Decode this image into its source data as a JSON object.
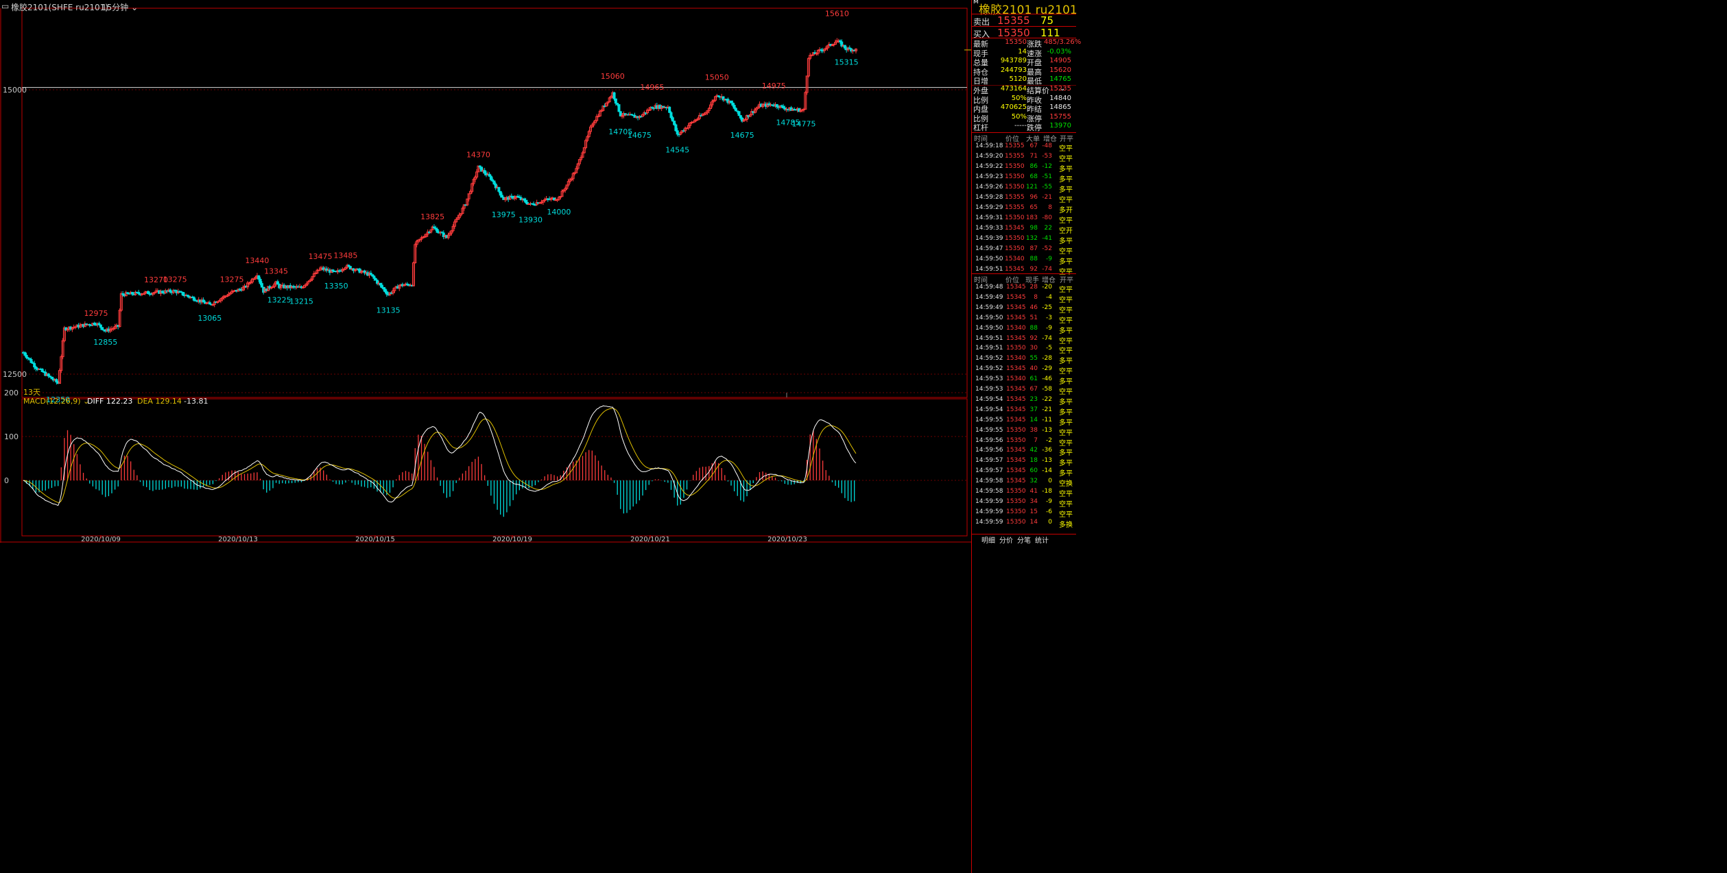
{
  "titlebar": {
    "menu_icon": "window-menu-icon",
    "symbol": "橡胶2101(SHFE ru2101)",
    "period": "15分钟",
    "period_icon": "chevron-down-icon"
  },
  "chart": {
    "y_axis": {
      "min": 12300,
      "max": 15800,
      "ticks": [
        15000,
        12500
      ]
    },
    "x_axis_labels": [
      "2020/10/09",
      "2020/10/13",
      "2020/10/15",
      "2020/10/19",
      "2020/10/21",
      "2020/10/23"
    ],
    "days_label": "13天",
    "hline_price": 15020,
    "last_price": 15350,
    "annotations": [
      {
        "bar": 22,
        "text": "12350",
        "type": "low"
      },
      {
        "bar": 46,
        "text": "12975",
        "type": "high"
      },
      {
        "bar": 52,
        "text": "12855",
        "type": "low"
      },
      {
        "bar": 84,
        "text": "13270",
        "type": "high"
      },
      {
        "bar": 96,
        "text": "13275",
        "type": "high"
      },
      {
        "bar": 118,
        "text": "13065",
        "type": "low"
      },
      {
        "bar": 132,
        "text": "13275",
        "type": "high"
      },
      {
        "bar": 148,
        "text": "13440",
        "type": "high"
      },
      {
        "bar": 160,
        "text": "13345",
        "type": "high"
      },
      {
        "bar": 162,
        "text": "13225",
        "type": "low"
      },
      {
        "bar": 176,
        "text": "13215",
        "type": "low"
      },
      {
        "bar": 188,
        "text": "13475",
        "type": "high"
      },
      {
        "bar": 198,
        "text": "13350",
        "type": "low"
      },
      {
        "bar": 204,
        "text": "13485",
        "type": "high"
      },
      {
        "bar": 231,
        "text": "13135",
        "type": "low"
      },
      {
        "bar": 259,
        "text": "13825",
        "type": "high"
      },
      {
        "bar": 288,
        "text": "14370",
        "type": "high"
      },
      {
        "bar": 304,
        "text": "13975",
        "type": "low"
      },
      {
        "bar": 321,
        "text": "13930",
        "type": "low"
      },
      {
        "bar": 339,
        "text": "14000",
        "type": "low"
      },
      {
        "bar": 373,
        "text": "15060",
        "type": "high"
      },
      {
        "bar": 378,
        "text": "14705",
        "type": "low"
      },
      {
        "bar": 390,
        "text": "14675",
        "type": "low"
      },
      {
        "bar": 398,
        "text": "14965",
        "type": "high"
      },
      {
        "bar": 414,
        "text": "14545",
        "type": "low"
      },
      {
        "bar": 439,
        "text": "15050",
        "type": "high"
      },
      {
        "bar": 455,
        "text": "14675",
        "type": "low"
      },
      {
        "bar": 475,
        "text": "14975",
        "type": "high"
      },
      {
        "bar": 484,
        "text": "14785",
        "type": "low"
      },
      {
        "bar": 494,
        "text": "14775",
        "type": "low"
      },
      {
        "bar": 515,
        "text": "15610",
        "type": "high"
      },
      {
        "bar": 521,
        "text": "15315",
        "type": "low"
      }
    ]
  },
  "macd": {
    "label": "MACD(12,26,9)",
    "label_icon": "chevron-down-icon",
    "diff_label": "DIFF 122.23",
    "dea_label": "DEA 129.14",
    "macd_value": "-13.81",
    "y_ticks": [
      200,
      100,
      0
    ]
  },
  "quote": {
    "title": "橡胶2101 ru2101",
    "title_badge": "M",
    "sell_label": "卖出",
    "sell_price": "15355",
    "sell_vol": "75",
    "buy_label": "买入",
    "buy_price": "15350",
    "buy_vol": "111",
    "rows": [
      {
        "l1": "最新",
        "v1": "15350",
        "c1": "red",
        "l2": "涨跌",
        "v2": "485/3.26%",
        "c2": "red"
      },
      {
        "l1": "现手",
        "v1": "14",
        "c1": "yel",
        "l2": "速涨",
        "v2": "-0.03%",
        "c2": "grn"
      },
      {
        "l1": "总量",
        "v1": "943789",
        "c1": "yel",
        "l2": "开盘",
        "v2": "14905",
        "c2": "red"
      },
      {
        "l1": "持仓",
        "v1": "244793",
        "c1": "yel",
        "l2": "最高",
        "v2": "15620",
        "c2": "red"
      },
      {
        "l1": "日增",
        "v1": "5120",
        "c1": "yel",
        "l2": "最低",
        "v2": "14765",
        "c2": "grn"
      },
      {
        "l1": "外盘",
        "v1": "473164",
        "c1": "yel",
        "l2": "结算价",
        "v2": "15235",
        "c2": "red"
      },
      {
        "l1": "比例",
        "v1": "50%",
        "c1": "yel",
        "l2": "昨收",
        "v2": "14840",
        "c2": "wht"
      },
      {
        "l1": "内盘",
        "v1": "470625",
        "c1": "yel",
        "l2": "昨结",
        "v2": "14865",
        "c2": "wht"
      },
      {
        "l1": "比例",
        "v1": "50%",
        "c1": "yel",
        "l2": "涨停",
        "v2": "15755",
        "c2": "red"
      },
      {
        "l1": "杠杆",
        "v1": "-----",
        "c1": "wht",
        "l2": "跌停",
        "v2": "13970",
        "c2": "grn"
      }
    ],
    "settle_icon": "chevron-down-icon"
  },
  "big_trades": {
    "headers": [
      "时间",
      "价位",
      "大单",
      "增仓",
      "开平"
    ],
    "rows": [
      [
        "14:59:18",
        "15355",
        "67",
        "-48",
        "空平",
        "red",
        "red",
        "red",
        "yel"
      ],
      [
        "14:59:20",
        "15355",
        "71",
        "-53",
        "空平",
        "red",
        "red",
        "red",
        "yel"
      ],
      [
        "14:59:22",
        "15350",
        "86",
        "-12",
        "多平",
        "red",
        "grn",
        "grn",
        "yel"
      ],
      [
        "14:59:23",
        "15350",
        "68",
        "-51",
        "多平",
        "red",
        "grn",
        "grn",
        "yel"
      ],
      [
        "14:59:26",
        "15350",
        "121",
        "-55",
        "多平",
        "red",
        "grn",
        "grn",
        "yel"
      ],
      [
        "14:59:28",
        "15355",
        "96",
        "-21",
        "空平",
        "red",
        "red",
        "red",
        "yel"
      ],
      [
        "14:59:29",
        "15355",
        "65",
        "8",
        "多开",
        "red",
        "red",
        "red",
        "yel"
      ],
      [
        "14:59:31",
        "15350",
        "183",
        "-80",
        "空平",
        "red",
        "red",
        "red",
        "yel"
      ],
      [
        "14:59:33",
        "15345",
        "98",
        "22",
        "空开",
        "red",
        "grn",
        "grn",
        "yel"
      ],
      [
        "14:59:39",
        "15350",
        "132",
        "-41",
        "多平",
        "red",
        "grn",
        "grn",
        "yel"
      ],
      [
        "14:59:47",
        "15350",
        "87",
        "-52",
        "空平",
        "red",
        "red",
        "red",
        "yel"
      ],
      [
        "14:59:50",
        "15340",
        "88",
        "-9",
        "多平",
        "red",
        "grn",
        "grn",
        "yel"
      ],
      [
        "14:59:51",
        "15345",
        "92",
        "-74",
        "空平",
        "red",
        "red",
        "red",
        "yel"
      ]
    ]
  },
  "ticks": {
    "headers": [
      "时间",
      "价位",
      "现手",
      "增仓",
      "开平"
    ],
    "rows": [
      [
        "14:59:48",
        "15345",
        "28",
        "-20",
        "空平",
        "red"
      ],
      [
        "14:59:49",
        "15345",
        "8",
        "-4",
        "空平",
        "red"
      ],
      [
        "14:59:49",
        "15345",
        "46",
        "-25",
        "空平",
        "red"
      ],
      [
        "14:59:50",
        "15345",
        "51",
        "-3",
        "空平",
        "red"
      ],
      [
        "14:59:50",
        "15340",
        "88",
        "-9",
        "多平",
        "grn"
      ],
      [
        "14:59:51",
        "15345",
        "92",
        "-74",
        "空平",
        "red"
      ],
      [
        "14:59:51",
        "15350",
        "30",
        "-5",
        "空平",
        "red"
      ],
      [
        "14:59:52",
        "15340",
        "55",
        "-28",
        "多平",
        "grn"
      ],
      [
        "14:59:52",
        "15345",
        "40",
        "-29",
        "空平",
        "red"
      ],
      [
        "14:59:53",
        "15340",
        "61",
        "-46",
        "多平",
        "grn"
      ],
      [
        "14:59:53",
        "15345",
        "67",
        "-58",
        "空平",
        "red"
      ],
      [
        "14:59:54",
        "15345",
        "23",
        "-22",
        "多平",
        "grn"
      ],
      [
        "14:59:54",
        "15345",
        "37",
        "-21",
        "多平",
        "grn"
      ],
      [
        "14:59:55",
        "15345",
        "14",
        "-11",
        "多平",
        "grn"
      ],
      [
        "14:59:55",
        "15350",
        "38",
        "-13",
        "空平",
        "red"
      ],
      [
        "14:59:56",
        "15350",
        "7",
        "-2",
        "空平",
        "red"
      ],
      [
        "14:59:56",
        "15345",
        "42",
        "-36",
        "多平",
        "grn"
      ],
      [
        "14:59:57",
        "15345",
        "18",
        "-13",
        "多平",
        "grn"
      ],
      [
        "14:59:57",
        "15345",
        "60",
        "-14",
        "多平",
        "grn"
      ],
      [
        "14:59:58",
        "15345",
        "32",
        "0",
        "空换",
        "grn"
      ],
      [
        "14:59:58",
        "15350",
        "41",
        "-18",
        "空平",
        "red"
      ],
      [
        "14:59:59",
        "15350",
        "34",
        "-9",
        "空平",
        "red"
      ],
      [
        "14:59:59",
        "15350",
        "15",
        "-6",
        "空平",
        "red"
      ],
      [
        "14:59:59",
        "15350",
        "14",
        "0",
        "多换",
        "red"
      ]
    ]
  },
  "bottom_tabs": [
    "明细",
    "分价",
    "分笔",
    "统计"
  ],
  "colors": {
    "up": "#ff3c3c",
    "down": "#00dcdc",
    "axis": "#c00000",
    "diff": "#ffffff",
    "dea": "#e0c000"
  }
}
